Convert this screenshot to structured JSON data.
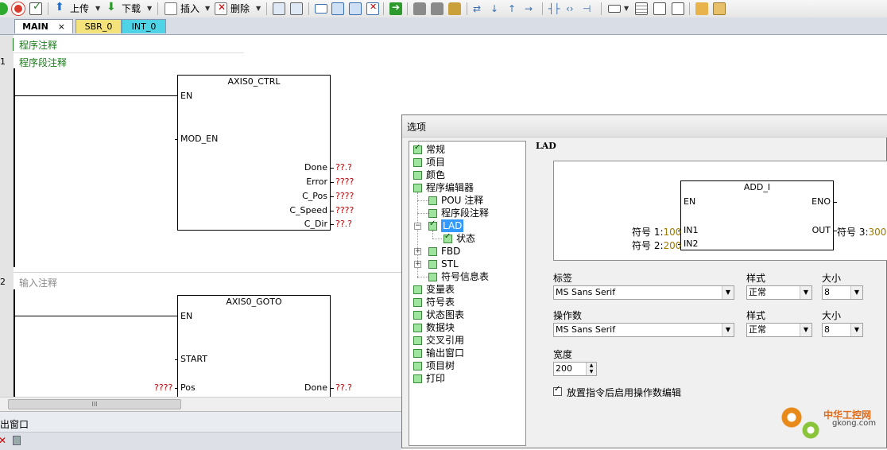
{
  "toolbar": {
    "upload_label": "上传",
    "download_label": "下载",
    "insert_label": "插入",
    "delete_label": "删除"
  },
  "tabs": [
    {
      "label": "MAIN",
      "close": "×",
      "color": "#ffffff"
    },
    {
      "label": "SBR_0",
      "color": "#f4e27a"
    },
    {
      "label": "INT_0",
      "color": "#4fd3e6"
    }
  ],
  "editor": {
    "program_comment": "程序注释",
    "networks": [
      {
        "number": "1",
        "comment": "程序段注释",
        "block": {
          "title": "AXIS0_CTRL",
          "inputs": [
            "EN",
            "MOD_EN"
          ],
          "outputs": [
            {
              "pin": "Done",
              "value": "??.?"
            },
            {
              "pin": "Error",
              "value": "????"
            },
            {
              "pin": "C_Pos",
              "value": "????"
            },
            {
              "pin": "C_Speed",
              "value": "????"
            },
            {
              "pin": "C_Dir",
              "value": "??.?"
            }
          ]
        }
      },
      {
        "number": "2",
        "comment": "输入注释",
        "block": {
          "title": "AXIS0_GOTO",
          "inputs": [
            "EN",
            "START",
            "Pos"
          ],
          "pos_value": "????",
          "outputs": [
            {
              "pin": "Done",
              "value": "??.?"
            }
          ]
        }
      }
    ]
  },
  "scrollbar_grip": "III",
  "output_window": {
    "title": "出窗口"
  },
  "dialog": {
    "title": "选项",
    "tree": [
      {
        "label": "常规",
        "checked": true
      },
      {
        "label": "项目"
      },
      {
        "label": "颜色"
      },
      {
        "label": "程序编辑器"
      },
      {
        "label": "POU 注释"
      },
      {
        "label": "程序段注释"
      },
      {
        "label": "LAD",
        "selected": true,
        "checked": true
      },
      {
        "label": "状态",
        "checked": true
      },
      {
        "label": "FBD"
      },
      {
        "label": "STL"
      },
      {
        "label": "符号信息表"
      },
      {
        "label": "变量表"
      },
      {
        "label": "符号表"
      },
      {
        "label": "状态图表"
      },
      {
        "label": "数据块"
      },
      {
        "label": "交叉引用"
      },
      {
        "label": "输出窗口"
      },
      {
        "label": "项目树"
      },
      {
        "label": "打印"
      }
    ],
    "section_title": "LAD",
    "preview": {
      "block_title": "ADD_I",
      "en": "EN",
      "eno": "ENO",
      "in1": "IN1",
      "in2": "IN2",
      "out": "OUT",
      "sym1_label": "符号 1:",
      "sym1_value": "100",
      "sym2_label": "符号 2:",
      "sym2_value": "200",
      "sym3_label": "符号 3:",
      "sym3_value": "300"
    },
    "label_font": {
      "label": "标签",
      "font": "MS Sans Serif",
      "style_label": "样式",
      "style": "正常",
      "size_label": "大小",
      "size": "8"
    },
    "operand_font": {
      "label": "操作数",
      "font": "MS Sans Serif",
      "style_label": "样式",
      "style": "正常",
      "size_label": "大小",
      "size": "8"
    },
    "width": {
      "label": "宽度",
      "value": "200"
    },
    "checkbox": {
      "label": "放置指令后启用操作数编辑",
      "checked": true
    }
  },
  "watermark": {
    "text": "中华工控网",
    "sub": "gkong.com"
  }
}
